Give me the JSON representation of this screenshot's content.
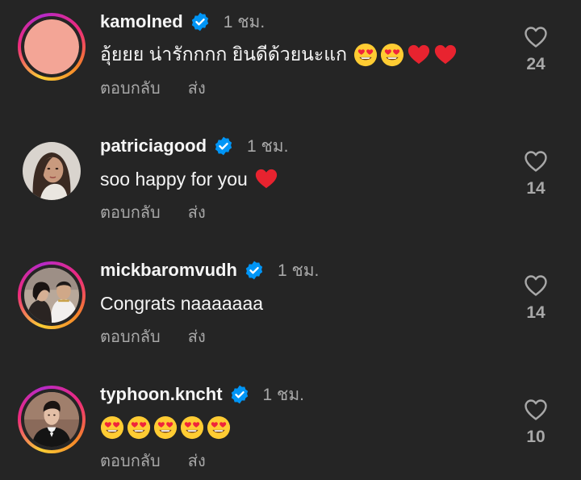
{
  "comments": [
    {
      "username": "kamolned",
      "time": "1 ชม.",
      "text": "อุ้ยยย น่ารักกกก ยินดีด้วยนะแก",
      "emojis": [
        "heart-eyes",
        "heart-eyes",
        "red-heart",
        "red-heart"
      ],
      "reply_label": "ตอบกลับ",
      "send_label": "ส่ง",
      "likes": "24",
      "avatar": "pink-circle",
      "has_story_ring": true
    },
    {
      "username": "patriciagood",
      "time": "1 ชม.",
      "text": "soo happy for you",
      "emojis": [
        "red-heart"
      ],
      "reply_label": "ตอบกลับ",
      "send_label": "ส่ง",
      "likes": "14",
      "avatar": "woman-portrait",
      "has_story_ring": false
    },
    {
      "username": "mickbaromvudh",
      "time": "1 ชม.",
      "text": "Congrats naaaaaaa",
      "emojis": [],
      "reply_label": "ตอบกลับ",
      "send_label": "ส่ง",
      "likes": "14",
      "avatar": "couple-photo",
      "has_story_ring": true
    },
    {
      "username": "typhoon.kncht",
      "time": "1 ชม.",
      "text": "",
      "emojis": [
        "heart-eyes",
        "heart-eyes",
        "heart-eyes",
        "heart-eyes",
        "heart-eyes"
      ],
      "reply_label": "ตอบกลับ",
      "send_label": "ส่ง",
      "likes": "10",
      "avatar": "man-tuxedo",
      "has_story_ring": true
    }
  ],
  "colors": {
    "background": "#252525",
    "primary_text": "#f5f5f5",
    "secondary_text": "#a8a8a8",
    "verified_blue": "#0095f6",
    "story_ring": [
      "#f9ce34",
      "#ee2a7b",
      "#b62ac8"
    ]
  }
}
